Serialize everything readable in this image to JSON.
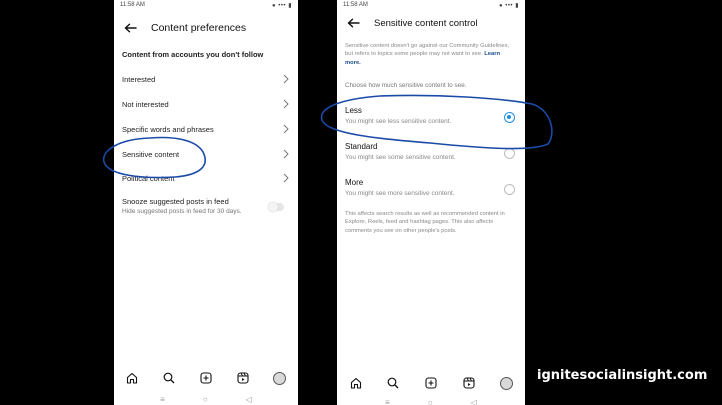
{
  "screen1": {
    "status_time": "11:58 AM",
    "status_icons": "● ••• ▮",
    "title": "Content preferences",
    "section_header": "Content from accounts you don't follow",
    "items": [
      {
        "label": "Interested"
      },
      {
        "label": "Not interested"
      },
      {
        "label": "Specific words and phrases"
      },
      {
        "label": "Sensitive content"
      },
      {
        "label": "Political content"
      }
    ],
    "snooze": {
      "title": "Snooze suggested posts in feed",
      "subtitle": "Hide suggested posts in feed for 30 days.",
      "enabled": false
    }
  },
  "screen2": {
    "status_time": "11:58 AM",
    "status_icons": "● ••• ▮",
    "title": "Sensitive content control",
    "description": "Sensitive content doesn't go against our Community Guidelines, but refers to topics some people may not want to see.",
    "learn_more": "Learn more.",
    "choose_label": "Choose how much sensitive content to see.",
    "options": [
      {
        "label": "Less",
        "sub": "You might see less sensitive content.",
        "selected": true
      },
      {
        "label": "Standard",
        "sub": "You might see some sensitive content.",
        "selected": false
      },
      {
        "label": "More",
        "sub": "You might see more sensitive content.",
        "selected": false
      }
    ],
    "footer": "This affects search results as well as recommended content in Explore, Reels, feed and hashtag pages. This also affects comments you see on other people's posts."
  },
  "nav_icons": [
    "home-icon",
    "search-icon",
    "create-icon",
    "reels-icon",
    "profile-icon"
  ],
  "system_nav": {
    "menu": "≡",
    "home": "○",
    "back": "◁"
  },
  "watermark": "ignitesocialinsight.com",
  "colors": {
    "accent": "#1d8fe0",
    "annotation": "#1a4aa8",
    "background": "#000000"
  }
}
